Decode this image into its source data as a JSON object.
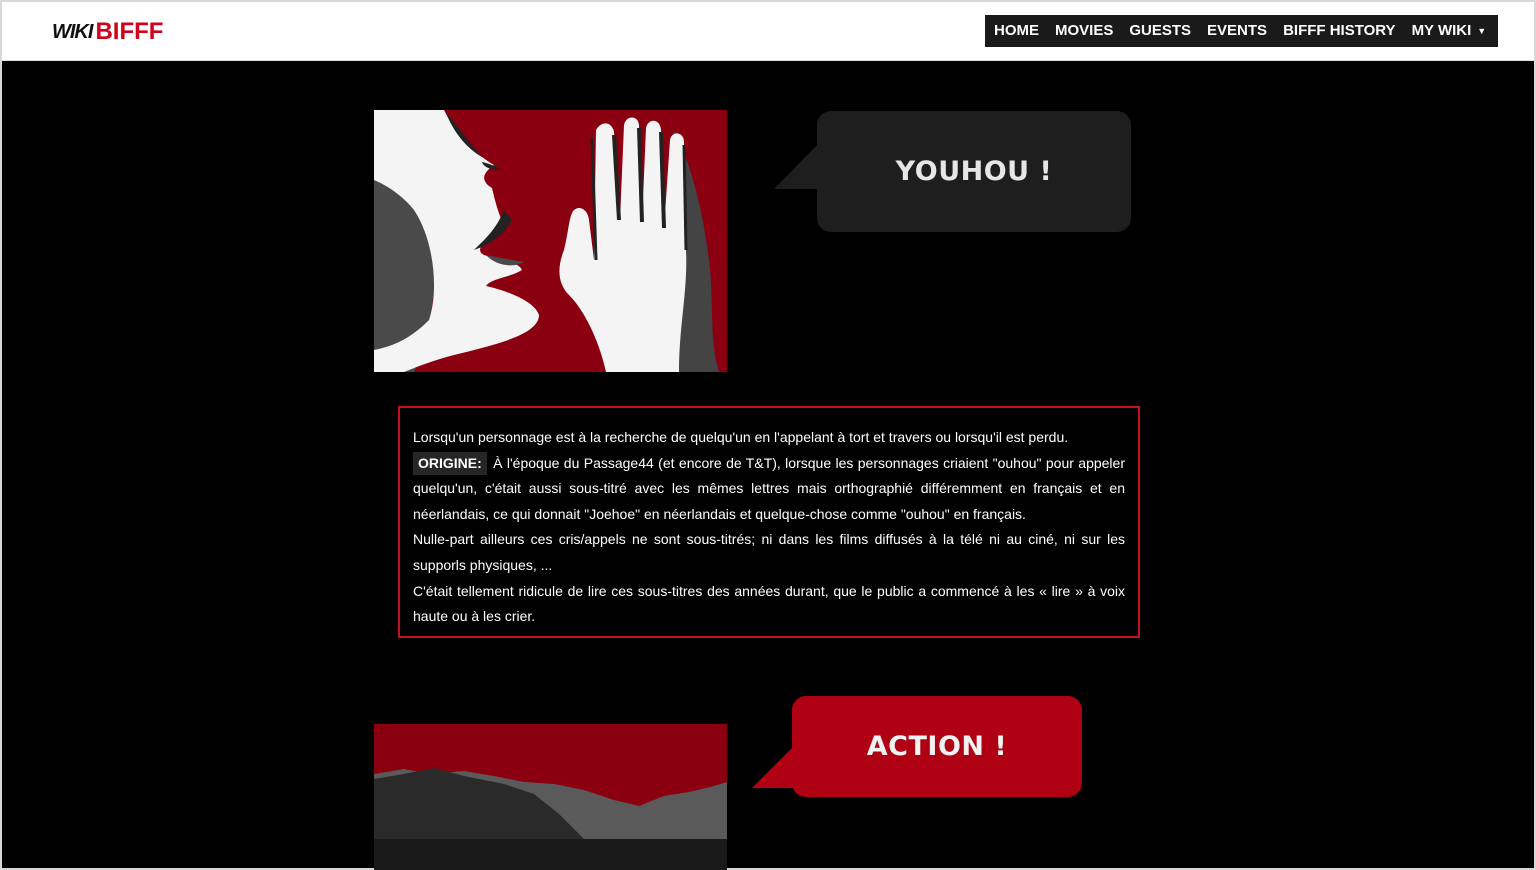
{
  "logo": {
    "wiki": "WIKI",
    "bifff": "BIFFF"
  },
  "nav": {
    "items": [
      {
        "label": "HOME"
      },
      {
        "label": "MOVIES"
      },
      {
        "label": "GUESTS"
      },
      {
        "label": "EVENTS"
      },
      {
        "label": "BIFFF HISTORY"
      },
      {
        "label": "MY WIKI"
      }
    ],
    "caret": "▼"
  },
  "section1": {
    "bubble_text": "YOUHOU !",
    "description": {
      "intro": "Lorsqu'un personnage est à la recherche de quelqu'un en l'appelant à tort et travers ou lorsqu'il est perdu.",
      "origin_label": "ORIGINE:",
      "origin_text": " À l'époque du Passage44 (et encore de T&T), lorsque les personnages criaient \"ouhou\" pour appeler quelqu'un, c'était aussi sous-titré avec les mêmes lettres mais orthographié différemment en français et en néerlandais, ce qui donnait \"Joehoe\" en néerlandais et quelque-chose comme \"ouhou\" en français.",
      "para2": "Nulle-part ailleurs ces cris/appels ne sont sous-titrés; ni dans les films diffusés à la télé ni au ciné, ni sur les supporls physiques, ...",
      "para3": "C'était tellement ridicule de lire ces sous-titres des années durant, que le public a commencé à les « lire » à voix haute ou à les crier."
    }
  },
  "section2": {
    "bubble_text": "ACTION !"
  },
  "colors": {
    "accent_red": "#d0021b",
    "image_red": "#8b0010",
    "bubble_dark": "#1e1e1e",
    "bubble_red": "#b00014",
    "border_red": "#c4111f"
  },
  "icons": [
    "caret-down-icon"
  ]
}
